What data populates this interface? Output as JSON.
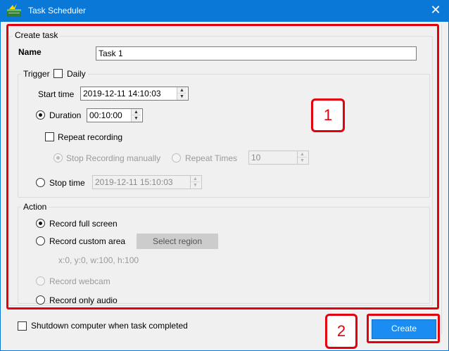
{
  "window": {
    "title": "Task Scheduler",
    "close_glyph": "✕",
    "title_bar_color": "#0a78d7",
    "app_icon": "scheduler-app-icon"
  },
  "create_task": {
    "legend": "Create task",
    "name_label": "Name",
    "name_value": "Task 1"
  },
  "trigger": {
    "legend": "Trigger",
    "daily_label": "Daily",
    "start_time_label": "Start time",
    "start_time_value": "2019-12-11 14:10:03",
    "duration_label": "Duration",
    "duration_value": "00:10:00",
    "repeat_recording_label": "Repeat recording",
    "stop_manually_label": "Stop Recording manually",
    "repeat_times_label": "Repeat Times",
    "repeat_times_value": "10",
    "stop_time_label": "Stop time",
    "stop_time_value": "2019-12-11 15:10:03"
  },
  "action": {
    "legend": "Action",
    "full_screen_label": "Record full screen",
    "custom_area_label": "Record custom area",
    "select_region_label": "Select region",
    "region_coords": "x:0, y:0, w:100, h:100",
    "webcam_label": "Record webcam",
    "only_audio_label": "Record only audio"
  },
  "footer": {
    "shutdown_label": "Shutdown computer when task completed",
    "create_label": "Create"
  },
  "annotations": {
    "badge_1": "1",
    "badge_2": "2",
    "highlight_color": "#e3000f"
  },
  "spinner": {
    "up_glyph": "▲",
    "down_glyph": "▼"
  }
}
